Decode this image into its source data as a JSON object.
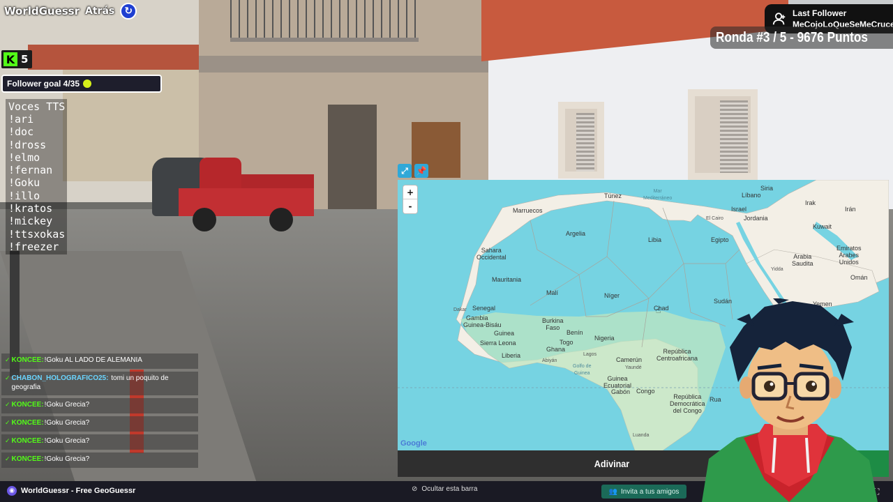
{
  "header": {
    "app_title": "WorldGuessr",
    "back_label": "Atrás"
  },
  "kick": {
    "viewer_count": "5"
  },
  "follower_goal": {
    "text": "Follower goal 4/35"
  },
  "tts": {
    "title": "Voces TTS",
    "commands": [
      "!ari",
      "!doc",
      "!dross",
      "!elmo",
      "!fernan",
      "!Goku",
      "!illo",
      "!kratos",
      "!mickey",
      "!ttsxokas",
      "!freezer"
    ]
  },
  "chat": {
    "messages": [
      {
        "user": "KONCEE:",
        "text": "!Goku AL LADO DE ALEMANIA",
        "user_color": "#53fc18"
      },
      {
        "user": "CHABON_HOLOGRAFICO25:",
        "text": " tomi un poquito de geografia",
        "user_color": "#6ad5ff"
      },
      {
        "user": "KONCEE:",
        "text": "!Goku Grecia?",
        "user_color": "#53fc18"
      },
      {
        "user": "KONCEE:",
        "text": "!Goku Grecia?",
        "user_color": "#53fc18"
      },
      {
        "user": "KONCEE:",
        "text": "!Goku Grecia?",
        "user_color": "#53fc18"
      },
      {
        "user": "KONCEE:",
        "text": "!Goku Grecia?",
        "user_color": "#53fc18"
      }
    ]
  },
  "last_follower": {
    "label": "Last Follower",
    "name": "MeCojoLoQueSeMeCruce"
  },
  "round": {
    "text": "Ronda #3 / 5 - 9676 Puntos"
  },
  "map": {
    "zoom_in": "+",
    "zoom_out": "-",
    "google": "Google",
    "labels": {
      "tunez": "Túnez",
      "mar_med": "Mar\nMediterráneo",
      "libano": "Líbano",
      "siria": "Siria",
      "irak": "Irak",
      "iran": "Irán",
      "israel": "Israel",
      "el_cairo": "El Cairo",
      "jordania": "Jordania",
      "kuwait": "Kuwait",
      "marruecos": "Marruecos",
      "argelia": "Argelia",
      "libia": "Libia",
      "egipto": "Egipto",
      "sahara": "Sahara\nOccidental",
      "arabia": "Arabia\nSaudita",
      "emiratos": "Emiratos\nÁrabes\nUnidos",
      "yidda": "Yidda",
      "oman": "Omán",
      "mauritania": "Mauritania",
      "mali": "Malí",
      "niger": "Níger",
      "chad": "Chad",
      "sudan": "Sudán",
      "yemen": "Yemen",
      "dakar": "Dakar",
      "senegal": "Senegal",
      "gambia": "Gambia",
      "guinea_bisau": "Guinea-Bisáu",
      "burkina": "Burkina\nFaso",
      "guinea": "Guinea",
      "benin": "Benín",
      "nigeria": "Nigeria",
      "sierra_leona": "Sierra Leona",
      "ghana": "Ghana",
      "togo": "Togo",
      "liberia": "Liberia",
      "abiyan": "Abiyán",
      "lagos": "Lagos",
      "golfo": "Golfo de\nGuinea",
      "camerun": "Camerún",
      "yaunde": "Yaundé",
      "rca": "República\nCentroafricana",
      "guinea_ec": "Guinea\nEcuatorial",
      "gabon": "Gabón",
      "congo": "Congo",
      "rdc": "República\nDemocrática\ndel Congo",
      "luanda": "Luanda",
      "rua": "Rua"
    }
  },
  "guess": {
    "button_label": "Adivinar"
  },
  "bottom_bar": {
    "brand": "WorldGuessr - Free GeoGuessr",
    "hide_bar": "Ocultar esta barra",
    "invite": "Invita a tus amigos"
  },
  "colors": {
    "kick_green": "#53fc18",
    "map_water": "#76d3e2",
    "map_land": "#f3efe6",
    "map_green": "#bfe6c0",
    "guess_green": "#1d8c45"
  }
}
